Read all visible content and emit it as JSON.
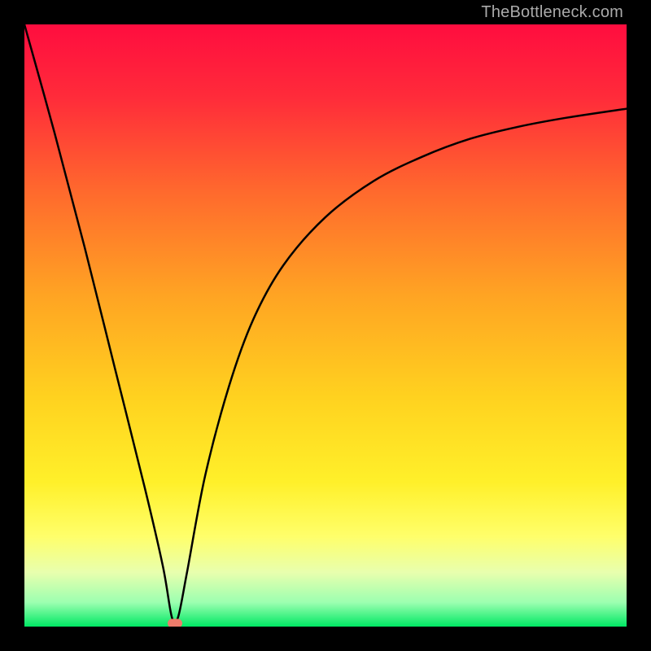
{
  "watermark": "TheBottleneck.com",
  "chart_data": {
    "type": "line",
    "title": "",
    "xlabel": "",
    "ylabel": "",
    "xlim": [
      0,
      1
    ],
    "ylim": [
      0,
      1
    ],
    "gradient_stops": [
      {
        "offset": 0.0,
        "color": "#ff0d3f"
      },
      {
        "offset": 0.12,
        "color": "#ff2b3a"
      },
      {
        "offset": 0.28,
        "color": "#ff6a2d"
      },
      {
        "offset": 0.45,
        "color": "#ffa423"
      },
      {
        "offset": 0.62,
        "color": "#ffd21f"
      },
      {
        "offset": 0.76,
        "color": "#fff02a"
      },
      {
        "offset": 0.85,
        "color": "#ffff6a"
      },
      {
        "offset": 0.91,
        "color": "#e8ffae"
      },
      {
        "offset": 0.96,
        "color": "#9cffb0"
      },
      {
        "offset": 1.0,
        "color": "#00e864"
      }
    ],
    "series": [
      {
        "name": "bottleneck-curve",
        "x": [
          0.0,
          0.05,
          0.1,
          0.15,
          0.2,
          0.23,
          0.245,
          0.255,
          0.27,
          0.3,
          0.34,
          0.38,
          0.43,
          0.5,
          0.58,
          0.66,
          0.74,
          0.82,
          0.9,
          1.0
        ],
        "y": [
          1.0,
          0.82,
          0.63,
          0.43,
          0.23,
          0.1,
          0.015,
          0.015,
          0.09,
          0.25,
          0.4,
          0.51,
          0.6,
          0.68,
          0.74,
          0.78,
          0.81,
          0.83,
          0.845,
          0.86
        ]
      }
    ],
    "marker": {
      "x": 0.25,
      "y": 0.005,
      "color": "#ed7c6b"
    }
  }
}
